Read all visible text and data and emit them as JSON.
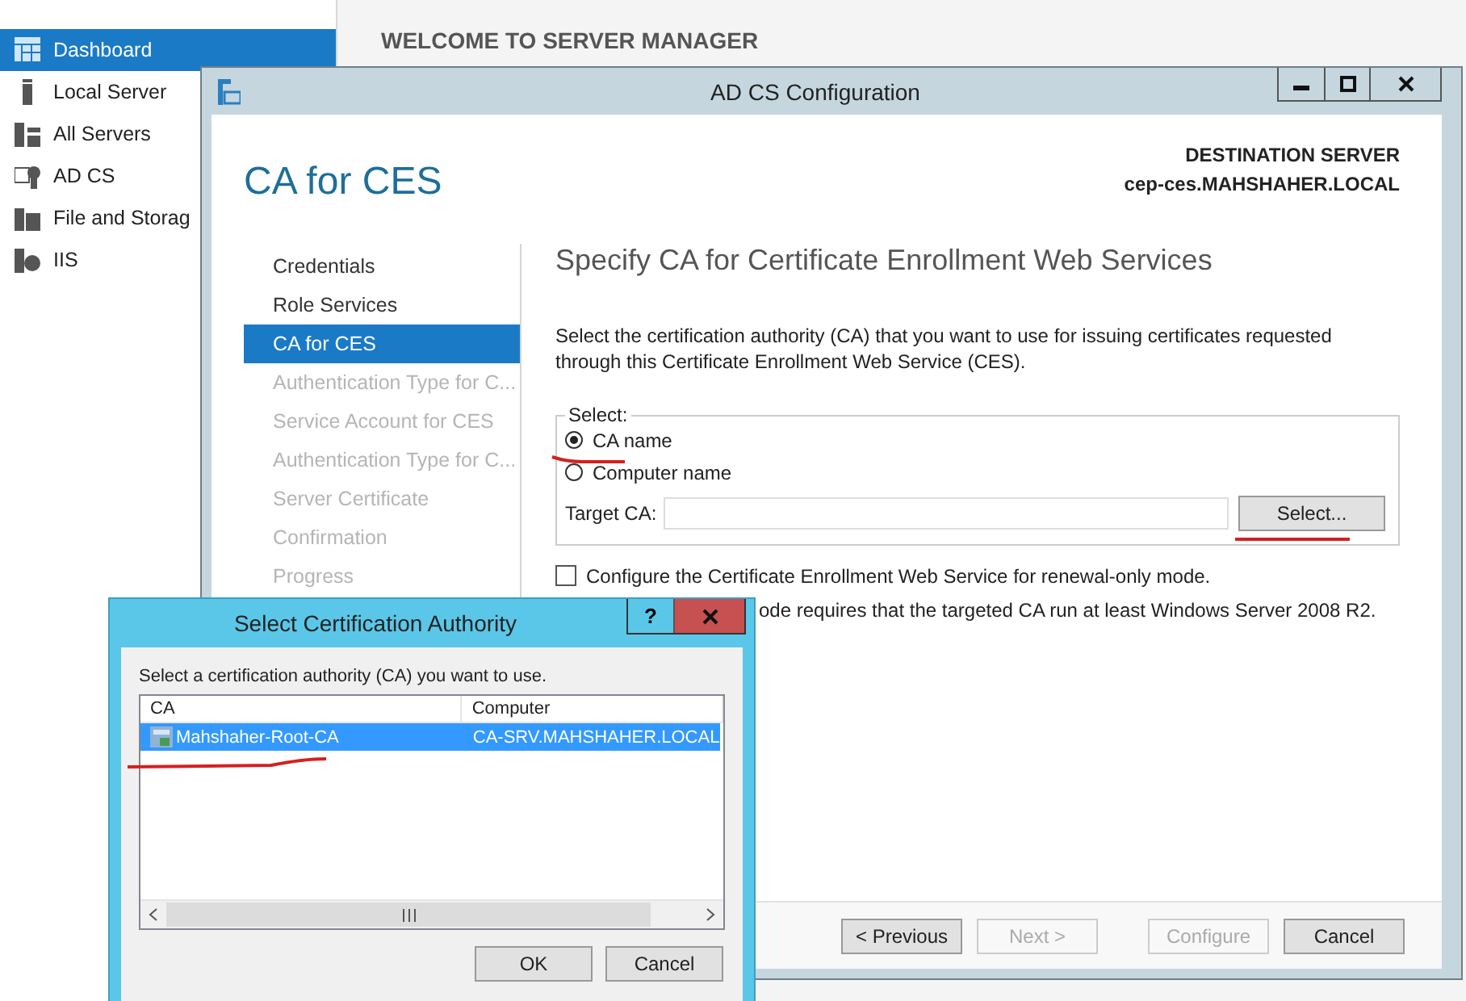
{
  "server_manager": {
    "sidebar": {
      "items": [
        {
          "label": "Dashboard",
          "selected": true,
          "kind": "dashboard"
        },
        {
          "label": "Local Server",
          "selected": false,
          "kind": "server"
        },
        {
          "label": "All Servers",
          "selected": false,
          "kind": "servers"
        },
        {
          "label": "AD CS",
          "selected": false,
          "kind": "adcs"
        },
        {
          "label": "File and Storag",
          "selected": false,
          "kind": "storage"
        },
        {
          "label": "IIS",
          "selected": false,
          "kind": "iis"
        }
      ]
    },
    "heading": "WELCOME TO SERVER MANAGER"
  },
  "config_window": {
    "title": "AD CS Configuration",
    "page_title": "CA for CES",
    "destination": {
      "label": "DESTINATION SERVER",
      "server": "cep-ces.MAHSHAHER.LOCAL"
    },
    "steps": [
      {
        "label": "Credentials",
        "selected": false,
        "disabled": false
      },
      {
        "label": "Role Services",
        "selected": false,
        "disabled": false
      },
      {
        "label": "CA for CES",
        "selected": true,
        "disabled": false
      },
      {
        "label": "Authentication Type for C...",
        "selected": false,
        "disabled": true
      },
      {
        "label": "Service Account for CES",
        "selected": false,
        "disabled": true
      },
      {
        "label": "Authentication Type for C...",
        "selected": false,
        "disabled": true
      },
      {
        "label": "Server Certificate",
        "selected": false,
        "disabled": true
      },
      {
        "label": "Confirmation",
        "selected": false,
        "disabled": true
      },
      {
        "label": "Progress",
        "selected": false,
        "disabled": true
      }
    ],
    "heading": "Specify CA for Certificate Enrollment Web Services",
    "description": "Select the certification authority (CA) that you want to use for issuing certificates requested through this Certificate Enrollment Web Service (CES).",
    "select_group": {
      "legend": "Select:",
      "options": [
        {
          "label": "CA name",
          "selected": true
        },
        {
          "label": "Computer name",
          "selected": false
        }
      ],
      "target_label": "Target CA:",
      "button": "Select..."
    },
    "renewal_option": {
      "label": "Configure the Certificate Enrollment Web Service for renewal-only mode.",
      "checked": false
    },
    "note": "ode requires that the targeted CA run at least Windows Server 2008 R2.",
    "buttons": [
      {
        "label": "< Previous",
        "disabled": false
      },
      {
        "label": "Next >",
        "disabled": true
      },
      {
        "label": "Configure",
        "disabled": true
      },
      {
        "label": "Cancel",
        "disabled": false
      }
    ]
  },
  "dialog": {
    "title": "Select Certification Authority",
    "help": "?",
    "prompt": "Select a certification authority (CA) you want to use.",
    "columns": [
      "CA",
      "Computer"
    ],
    "rows": [
      {
        "cells": [
          "Mahshaher-Root-CA",
          "CA-SRV.MAHSHAHER.LOCAL"
        ],
        "selected": true
      }
    ],
    "buttons": [
      "OK",
      "Cancel"
    ]
  }
}
